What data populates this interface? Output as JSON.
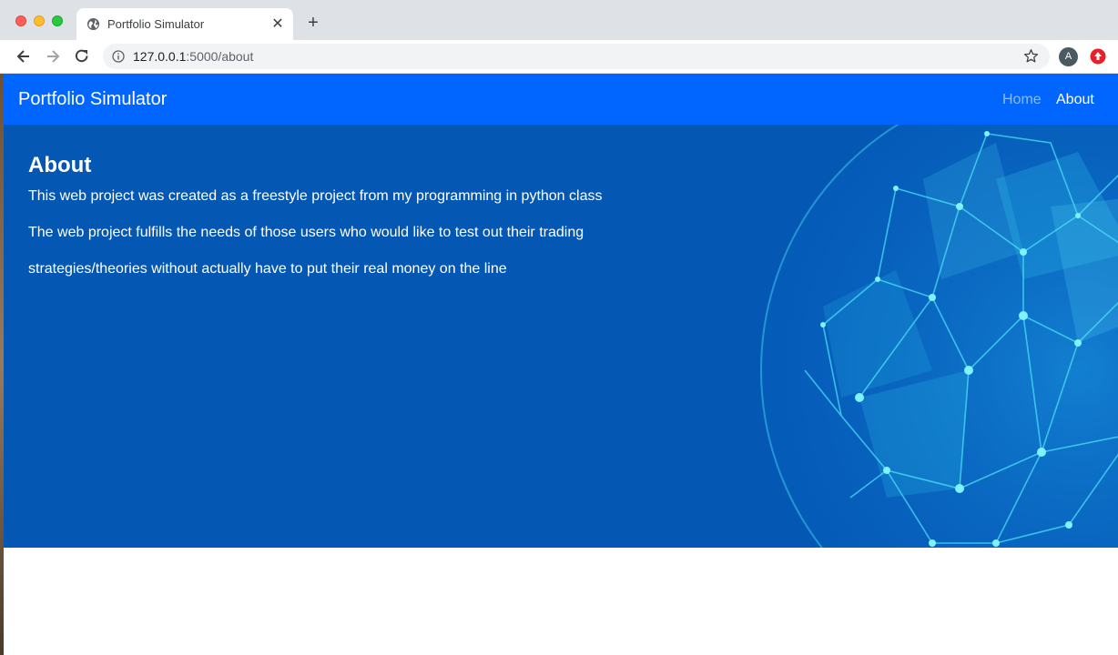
{
  "browser": {
    "tab_title": "Portfolio Simulator",
    "url_host": "127.0.0.1",
    "url_path": ":5000/about",
    "profile_initial": "A"
  },
  "navbar": {
    "brand": "Portfolio Simulator",
    "links": [
      {
        "label": "Home",
        "active": false
      },
      {
        "label": "About",
        "active": true
      }
    ]
  },
  "content": {
    "title": "About",
    "paragraphs": [
      "This web project was created as a freestyle project from my programming in python class",
      "The web project fulfills the needs of those users who would like to test out their trading",
      "strategies/theories without actually have to put their real money on the line"
    ]
  },
  "colors": {
    "navbar": "#0066ff",
    "hero": "#0457b3",
    "globe": "#2ed3f2"
  },
  "icons": [
    "globe-icon",
    "close-icon",
    "plus-icon",
    "back-icon",
    "forward-icon",
    "reload-icon",
    "info-icon",
    "star-icon",
    "extension-icon"
  ]
}
